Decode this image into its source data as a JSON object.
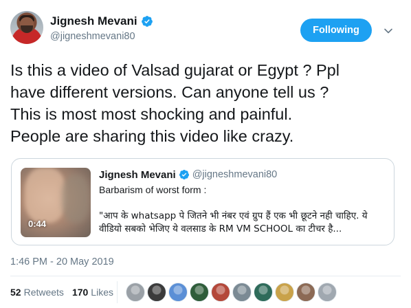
{
  "author": {
    "name": "Jignesh Mevani",
    "handle": "@jigneshmevani80",
    "verified_icon": "verified-badge-icon"
  },
  "follow_button": {
    "label": "Following"
  },
  "menu_icon": "chevron-down-icon",
  "tweet": {
    "text": "Is this a video of Valsad gujarat or Egypt ? Ppl\nhave different versions. Can anyone tell us ?\nThis is most most shocking and painful.\nPeople are sharing this video like crazy."
  },
  "quoted_tweet": {
    "name": "Jignesh Mevani",
    "handle": "@jigneshmevani80",
    "line1": "Barbarism of worst form :",
    "line2": "\"आप के whatsapp पे जितने भी नंबर एवं ग्रुप हैं एक भी छूटने नही चाहिए. ये वीडियो सबको भेजिए ये वलसाड के RM VM SCHOOL का टीचर है...",
    "video_duration": "0:44"
  },
  "timestamp": "1:46 PM - 20 May 2019",
  "stats": {
    "retweets_count": "52",
    "retweets_label": "Retweets",
    "likes_count": "170",
    "likes_label": "Likes"
  },
  "liker_avatars": [
    "#9aa0a6",
    "#3b3b3b",
    "#5b8fd6",
    "#2f5d3a",
    "#b4483a",
    "#7b8a94",
    "#2e6b5a",
    "#c9a24a",
    "#8c6a55",
    "#a0a8b0"
  ],
  "colors": {
    "accent": "#1da1f2",
    "text": "#14171a",
    "muted": "#657786",
    "border": "#ccd6dd"
  }
}
